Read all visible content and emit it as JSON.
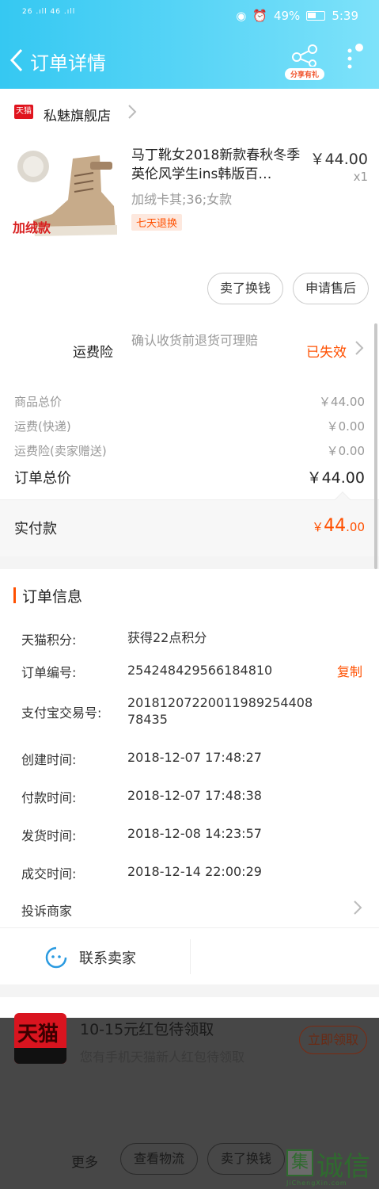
{
  "status_bar": {
    "network": "26 .ıll 46 .ıll",
    "battery": "49%",
    "time": "5:39"
  },
  "nav": {
    "title": "订单详情",
    "share_label": "分享有礼"
  },
  "store": {
    "logo_text": "天猫",
    "name": "私魅旗舰店"
  },
  "product": {
    "image_badge": "加绒款",
    "title": "马丁靴女2018新款春秋冬季英伦风学生ins韩版百…",
    "sku": "加绒卡其;36;女款",
    "tag": "七天退换",
    "price": "￥44.00",
    "qty": "x1"
  },
  "actions": {
    "sell": "卖了换钱",
    "after_sale": "申请售后"
  },
  "insurance": {
    "label": "运费险",
    "desc": "确认收货前退货可理赔",
    "status": "已失效"
  },
  "summary": {
    "rows": [
      {
        "label": "商品总价",
        "value": "￥44.00"
      },
      {
        "label": "运费(快递)",
        "value": "￥0.00"
      },
      {
        "label": "运费险(卖家赠送)",
        "value": "￥0.00"
      }
    ],
    "total_label": "订单总价",
    "total_value": "￥44.00",
    "paid_label": "实付款",
    "paid_currency": "￥",
    "paid_int": "44",
    "paid_dec": ".00"
  },
  "order_info": {
    "title": "订单信息",
    "rows": [
      {
        "key": "天猫积分:",
        "value": "获得22点积分"
      },
      {
        "key": "订单编号:",
        "value": "254248429566184810"
      },
      {
        "key": "支付宝交易号:",
        "value": "20181207220011989254408 78435"
      },
      {
        "key": "创建时间:",
        "value": "2018-12-07 17:48:27"
      },
      {
        "key": "付款时间:",
        "value": "2018-12-07 17:48:38"
      },
      {
        "key": "发货时间:",
        "value": "2018-12-08 14:23:57"
      },
      {
        "key": "成交时间:",
        "value": "2018-12-14 22:00:29"
      }
    ],
    "copy": "复制",
    "complaint": "投诉商家"
  },
  "contact": {
    "label": "联系卖家"
  },
  "promo": {
    "logo_text": "天猫",
    "title": "10-15元红包待领取",
    "subtitle": "您有手机天猫新人红包待领取",
    "button": "立即领取"
  },
  "bottom_bar": {
    "more": "更多",
    "logistics": "查看物流",
    "sell": "卖了换钱"
  },
  "watermark": {
    "box": "集",
    "text": "诚信",
    "sub": "JiChengXin.com"
  },
  "colors": {
    "accent": "#ff5000",
    "header_start": "#35c8f2",
    "header_end": "#7ee2fa"
  }
}
